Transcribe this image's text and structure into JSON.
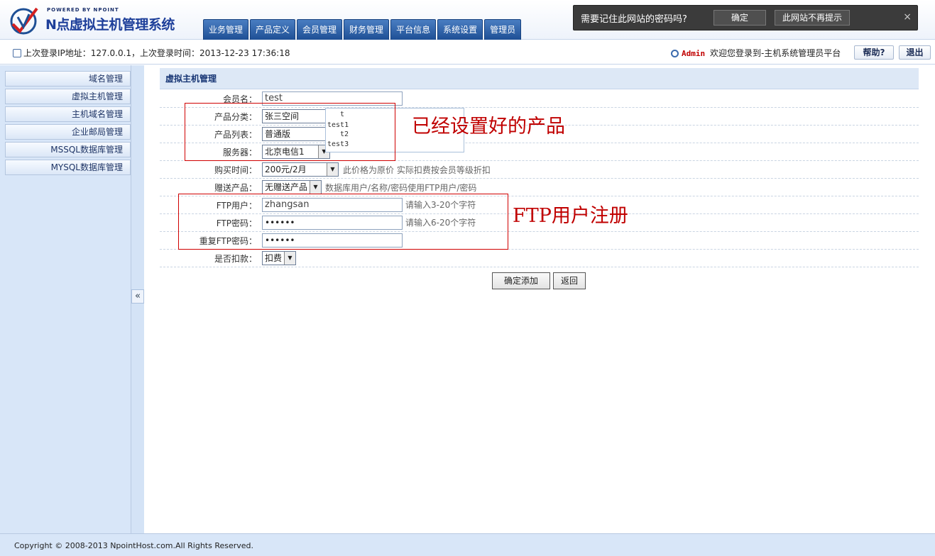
{
  "logo": {
    "powered": "POWERED BY NPOINT",
    "name": "N点虚拟主机管理系统"
  },
  "nav": [
    "业务管理",
    "产品定义",
    "会员管理",
    "财务管理",
    "平台信息",
    "系统设置",
    "管理员"
  ],
  "password_prompt": {
    "message": "需要记住此网站的密码吗?",
    "confirm": "确定",
    "never": "此网站不再提示",
    "close": "×"
  },
  "infobar": {
    "last_login": "上次登录IP地址：127.0.0.1，上次登录时间：2013-12-23 17:36:18",
    "admin": "Admin",
    "welcome": "欢迎您登录到-主机系统管理员平台",
    "help": "帮助?",
    "logout": "退出"
  },
  "sidebar": [
    "域名管理",
    "虚拟主机管理",
    "主机域名管理",
    "企业邮局管理",
    "MSSQL数据库管理",
    "MYSQL数据库管理"
  ],
  "collapse": "«",
  "panel_title": "虚拟主机管理",
  "form": {
    "member_label": "会员名：",
    "member_value": "test",
    "category_label": "产品分类：",
    "category_value": "张三空间",
    "product_label": "产品列表：",
    "product_value": "普通版",
    "server_label": "服务器：",
    "server_value": "北京电信1",
    "duration_label": "购买时间：",
    "duration_value": "200元/2月",
    "duration_hint": "此价格为原价 实际扣费按会员等级折扣",
    "gift_label": "赠送产品：",
    "gift_value": "无赠送产品",
    "gift_hint": "数据库用户/名称/密码使用FTP用户/密码",
    "ftp_user_label": "FTP用户：",
    "ftp_user_value": "zhangsan",
    "ftp_user_hint": "请输入3-20个字符",
    "ftp_pw_label": "FTP密码：",
    "ftp_pw_value": "••••••",
    "ftp_pw_hint": "请输入6-20个字符",
    "ftp_pw2_label": "重复FTP密码：",
    "ftp_pw2_value": "••••••",
    "deduct_label": "是否扣款：",
    "deduct_value": "扣费",
    "submit": "确定添加",
    "back": "返回"
  },
  "listbox_options": [
    "t",
    "test1",
    "t2",
    "test3"
  ],
  "annotations": {
    "products": "已经设置好的产品",
    "ftp": "FTP用户注册"
  },
  "footer": "Copyright © 2008-2013 NpointHost.com.All Rights Reserved.",
  "colors": {
    "nav": "#1e4f95",
    "annotation": "#c00000",
    "sidebar": "#d8e6f8"
  }
}
